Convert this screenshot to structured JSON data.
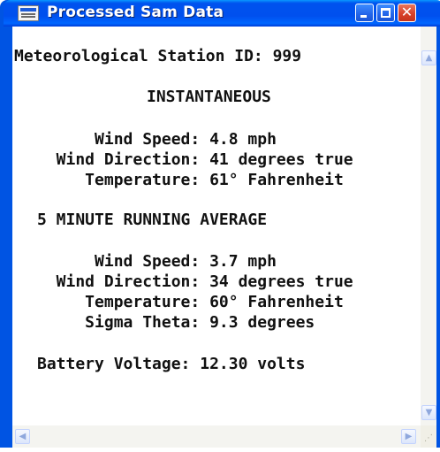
{
  "window": {
    "title": "Processed Sam Data",
    "title_color": "#ffffff",
    "titlebar_color": "#0054e3"
  },
  "icons": {
    "app": "app-window-icon",
    "minimize": "minimize-icon",
    "maximize": "maximize-icon",
    "close": "close-icon",
    "scroll_up": "arrow-up-icon",
    "scroll_down": "arrow-down-icon",
    "scroll_left": "arrow-left-icon",
    "scroll_right": "arrow-right-icon",
    "resize_grip": "resize-grip-icon"
  },
  "report": {
    "station_line": "Meteorological Station ID: 999",
    "instantaneous": {
      "heading": "INSTANTANEOUS",
      "wind_speed": "      Wind Speed: 4.8 mph",
      "wind_direction": "  Wind Direction: 41 degrees true",
      "temperature": "     Temperature: 61° Fahrenheit"
    },
    "average": {
      "heading": "5 MINUTE RUNNING AVERAGE",
      "wind_speed": "      Wind Speed: 3.7 mph",
      "wind_direction": "  Wind Direction: 34 degrees true",
      "temperature": "     Temperature: 60° Fahrenheit",
      "sigma_theta": "     Sigma Theta: 9.3 degrees"
    },
    "battery_line": "Battery Voltage: 12.30 volts"
  }
}
